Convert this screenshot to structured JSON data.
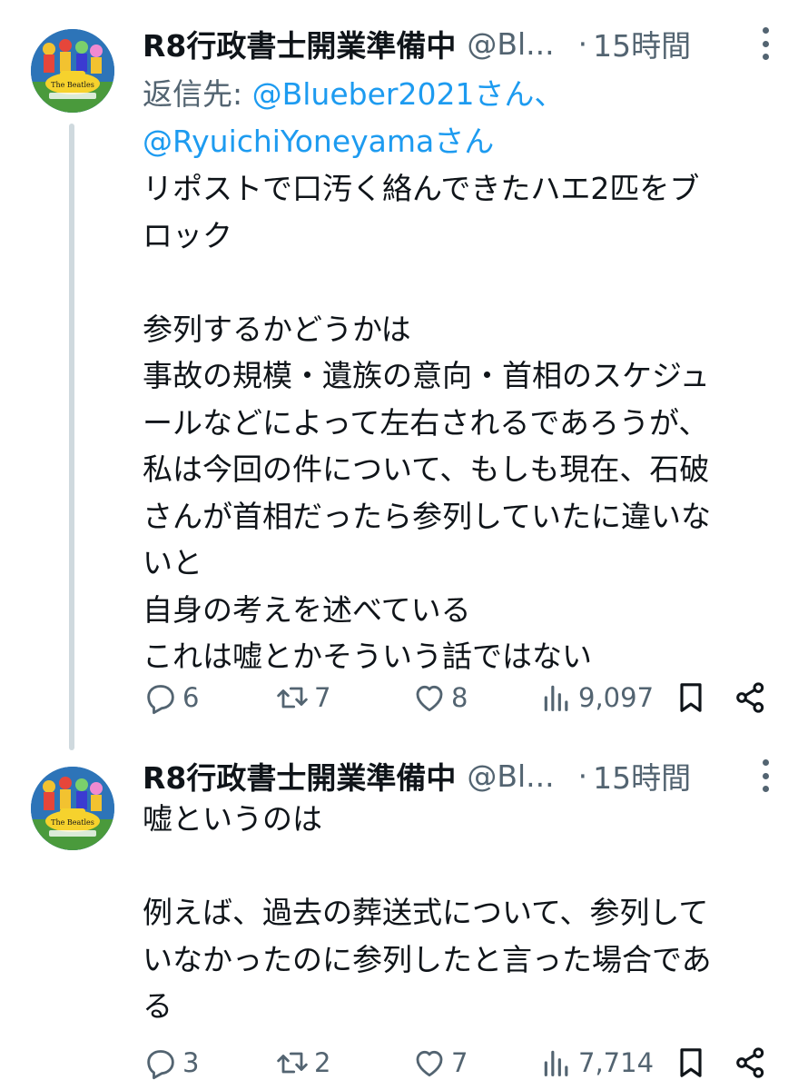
{
  "tweets": [
    {
      "display_name": "R8行政書士開業準備中",
      "handle": "@Bl...",
      "separator": "·",
      "time": "15時間",
      "reply_prefix": "返信先: ",
      "reply_mention_1": "@Blueber2021さん、",
      "reply_mention_2": "@RyuichiYoneyamaさん",
      "text": "リポストで口汚く絡んできたハエ2匹をブ\nロック\n\n参列するかどうかは\n事故の規模・遺族の意向・首相のスケジュ\nールなどによって左右されるであろうが、\n私は今回の件について、もしも現在、石破\nさんが首相だったら参列していたに違いな\nいと\n自身の考えを述べている\nこれは嘘とかそういう話ではない",
      "replies": "6",
      "reposts": "7",
      "likes": "8",
      "views": "9,097"
    },
    {
      "display_name": "R8行政書士開業準備中",
      "handle": "@Bl...",
      "separator": "·",
      "time": "15時間",
      "text": "嘘というのは\n\n例えば、過去の葬送式について、参列して\nいなかったのに参列したと言った場合であ\nる",
      "replies": "3",
      "reposts": "2",
      "likes": "7",
      "views": "7,714"
    }
  ],
  "colors": {
    "text": "#0f1419",
    "secondary": "#536471",
    "link": "#1d9bf0",
    "thread_line": "#cfd9de"
  },
  "icons": [
    "avatar",
    "more-icon",
    "reply-icon",
    "repost-icon",
    "like-icon",
    "views-icon",
    "bookmark-icon",
    "share-icon"
  ]
}
